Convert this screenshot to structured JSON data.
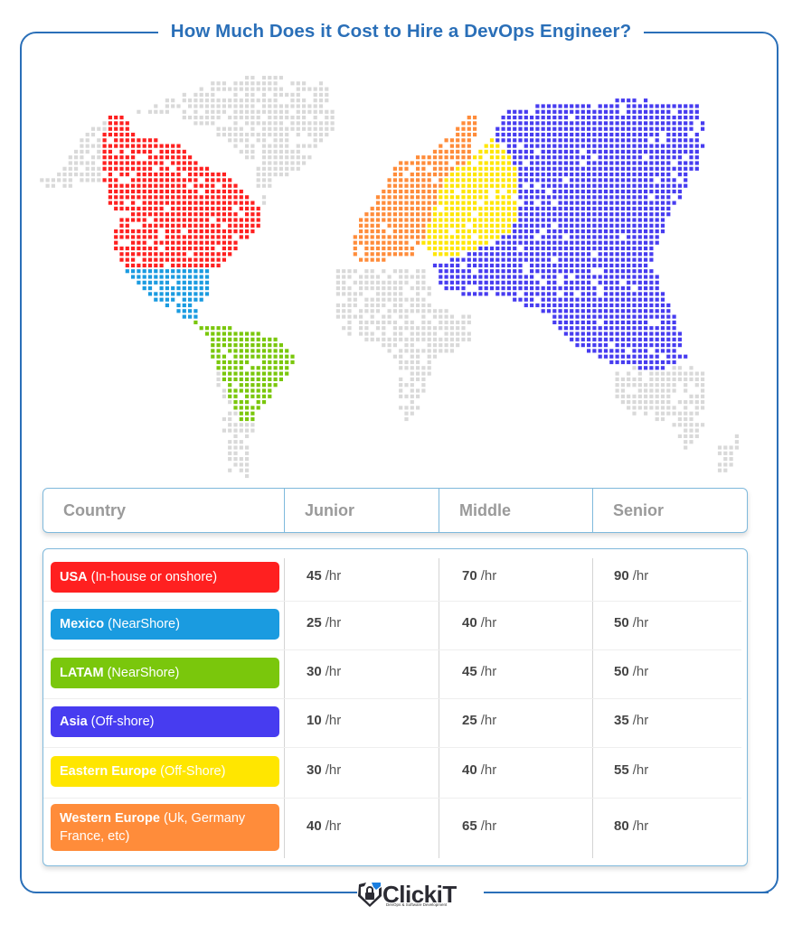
{
  "title": "How Much Does it Cost to Hire a DevOps Engineer?",
  "colors": {
    "frame": "#2a6fb8",
    "map_base": "#d9d9d9",
    "usa": "#ff2020",
    "mexico": "#1a9be0",
    "latam": "#7ac70c",
    "asia": "#473cf0",
    "eastern_europe": "#ffe600",
    "western_europe": "#ff8c3a"
  },
  "map": {
    "icon": "dotted-world-map",
    "regions": [
      "usa",
      "mexico",
      "latam",
      "asia",
      "eastern_europe",
      "western_europe"
    ]
  },
  "table": {
    "headers": [
      "Country",
      "Junior",
      "Middle",
      "Senior"
    ],
    "unit": "/hr",
    "rows": [
      {
        "key": "usa",
        "name": "USA",
        "note": "(In-house or onshore)",
        "color": "#ff2020",
        "junior": "45",
        "middle": "70",
        "senior": "90"
      },
      {
        "key": "mexico",
        "name": "Mexico",
        "note": "(NearShore)",
        "color": "#1a9be0",
        "junior": "25",
        "middle": "40",
        "senior": "50"
      },
      {
        "key": "latam",
        "name": "LATAM",
        "note": "(NearShore)",
        "color": "#7ac70c",
        "junior": "30",
        "middle": "45",
        "senior": "50"
      },
      {
        "key": "asia",
        "name": "Asia",
        "note": "(Off-shore)",
        "color": "#473cf0",
        "junior": "10",
        "middle": "25",
        "senior": "35"
      },
      {
        "key": "eastern_europe",
        "name": "Eastern Europe",
        "note": "(Off-Shore)",
        "color": "#ffe600",
        "junior": "30",
        "middle": "40",
        "senior": "55"
      },
      {
        "key": "western_europe",
        "name": "Western Europe",
        "note": "(Uk, Germany France, etc)",
        "color": "#ff8c3a",
        "junior": "40",
        "middle": "65",
        "senior": "80"
      }
    ]
  },
  "footer": {
    "logo_text": "ClickiT",
    "logo_tagline": "DevOps & Software Development",
    "logo_icon": "shield-lock-icon"
  }
}
